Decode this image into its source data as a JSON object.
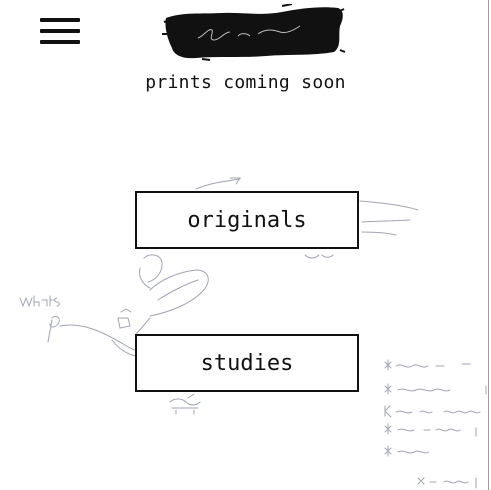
{
  "header": {
    "menu_icon": "hamburger-menu-icon",
    "logo_icon": "brush-stroke-signature-logo",
    "tagline": "prints coming soon"
  },
  "nav": {
    "originals_label": "originals",
    "studies_label": "studies"
  },
  "colors": {
    "background": "#ffffff",
    "text": "#111111",
    "button_border": "#111111",
    "sketch_stroke": "#8a8fa0"
  }
}
